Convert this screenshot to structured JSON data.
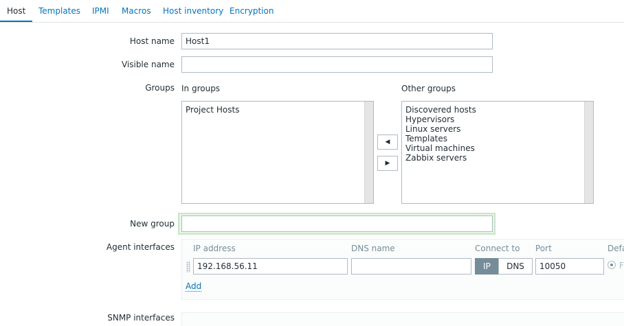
{
  "tabs": [
    {
      "label": "Host",
      "active": true
    },
    {
      "label": "Templates",
      "active": false
    },
    {
      "label": "IPMI",
      "active": false
    },
    {
      "label": "Macros",
      "active": false
    },
    {
      "label": "Host inventory",
      "active": false
    },
    {
      "label": "Encryption",
      "active": false
    }
  ],
  "form": {
    "host_name": {
      "label": "Host name",
      "value": "Host1"
    },
    "visible_name": {
      "label": "Visible name",
      "value": ""
    },
    "groups": {
      "label": "Groups",
      "in_groups_label": "In groups",
      "other_groups_label": "Other groups",
      "in_groups": [
        "Project Hosts"
      ],
      "other_groups": [
        "Discovered hosts",
        "Hypervisors",
        "Linux servers",
        "Templates",
        "Virtual machines",
        "Zabbix servers"
      ]
    },
    "new_group": {
      "label": "New group",
      "value": ""
    },
    "agent_interfaces": {
      "label": "Agent interfaces",
      "columns": {
        "ip": "IP address",
        "dns": "DNS name",
        "connect": "Connect to",
        "port": "Port",
        "default": "Defa"
      },
      "row": {
        "ip": "192.168.56.11",
        "dns": "",
        "connect_ip": "IP",
        "connect_dns": "DNS",
        "port": "10050",
        "default_glyph": "F"
      },
      "add_label": "Add"
    },
    "snmp_interfaces": {
      "label": "SNMP interfaces"
    }
  },
  "icons": {
    "move_left": "◀",
    "move_right": "▶"
  },
  "colors": {
    "accent": "#0275b8",
    "active_segment": "#768d99",
    "new_group_highlight": "#c9e5c9"
  }
}
